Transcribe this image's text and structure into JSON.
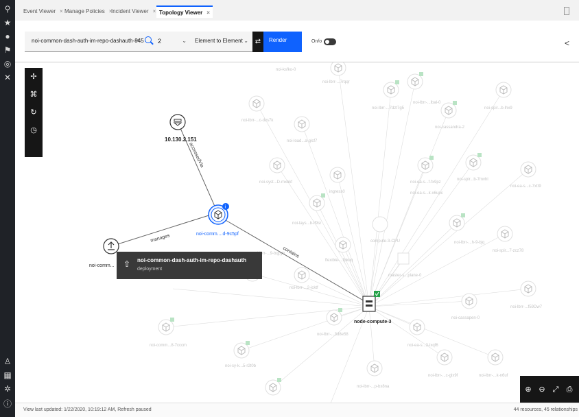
{
  "tabs": [
    {
      "label": "Event Viewer",
      "active": false
    },
    {
      "label": "Manage Policies",
      "active": false
    },
    {
      "label": "Incident Viewer",
      "active": false
    },
    {
      "label": "Topology Viewer",
      "active": true
    }
  ],
  "toolbar": {
    "search_value": "noi-common-dash-auth-im-repo-dashauth-845",
    "hops_value": "2",
    "hop_type_value": "Element to Element",
    "render_label": "Render",
    "toggle_label": "On/o"
  },
  "graph": {
    "nodes": {
      "ip": "10.130.2.151",
      "center": "noi-comm....d-9c5pf",
      "left": "noi-comm...",
      "compute": "node-compute-3"
    },
    "edges": {
      "accessed_via": "accessedVia",
      "manages": "manages",
      "contains": "contains"
    },
    "faded_labels": [
      "noi-ksfko-0",
      "noi-lbrr-...7rqqr",
      "noi-lbrr-...7dzt7g5",
      "noi-lbrr-...lbal-0",
      "noi-spir...b-lhx9",
      "noi-lbrr-...c-dvs7k",
      "noi-load...a-glcf7",
      "noi-cassandra-2",
      "noi-ea-s...f-fx9pz",
      "noi-spir...b-7mvhl",
      "noi-ea-s...c-7xtt9",
      "noi-syst...D-mxbkf",
      "ingress0",
      "noi-ea-s...k-x6upc",
      "noi-lays...b-lf9sr",
      "noi-lbrr-...h-9-bjq",
      "noi-spir...7-zcz78",
      "noi-lbrr-...9-bqpyh",
      "compute-3-CPU",
      "noi-lbrr-...2-jcktf",
      "flexible-...fpkqq",
      "master-s...plane-0",
      "noi-cassapen-0",
      "noi-lbrr-...f59Dw7",
      "noi-comm...8-7cccm",
      "noi-ea-s...3-lxqf6",
      "noi-sy-k...5-r2t0b",
      "noi-lbrr-...3d8e58",
      "noi-lbrr-...c-glx9f",
      "noi-lbrr-...k-n6uf",
      "noi-lbrr-...p-bx8na"
    ]
  },
  "tooltip": {
    "title": "noi-common-dash-auth-im-repo-dashauth",
    "subtitle": "deployment"
  },
  "status": {
    "left": "View last updated: 1/22/2020, 10:19:12 AM, Refresh paused",
    "right": "44 resources, 45 relationships"
  },
  "colors": {
    "accent": "#0f62fe",
    "status_ok": "#24a148",
    "dark": "#161616"
  },
  "icons": {
    "left_nav": [
      "search-icon",
      "star-icon",
      "user-icon",
      "flag-icon",
      "globe-icon",
      "wrench-icon",
      "person-icon",
      "grid-icon",
      "settings-icon",
      "help-icon"
    ]
  }
}
